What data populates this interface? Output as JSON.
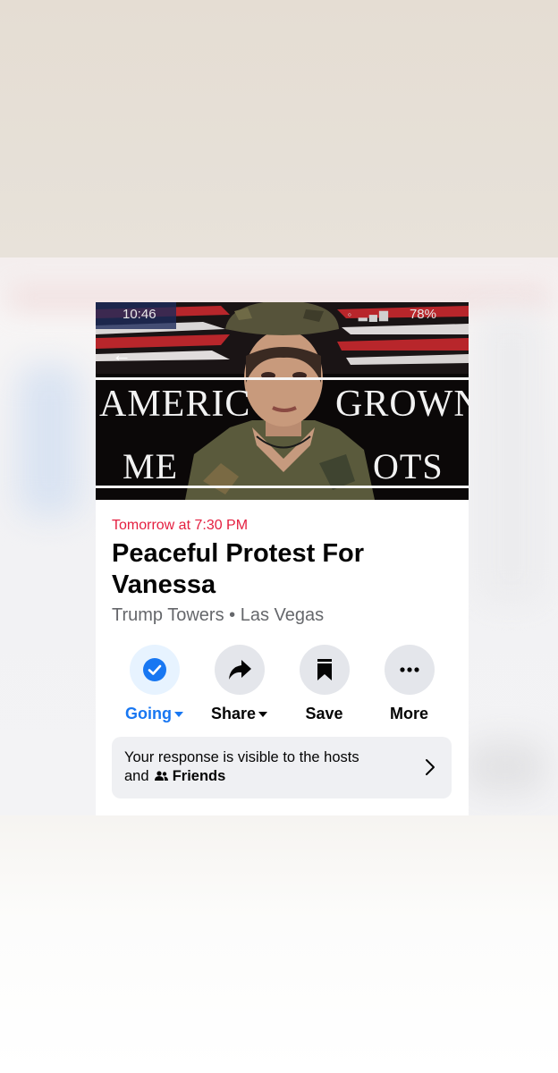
{
  "status_bar": {
    "time": "10:46",
    "battery": "78%"
  },
  "banner": {
    "line1_left": "AMERIC",
    "line1_right": "GROWN",
    "line2_left": "ME",
    "line2_right": "OTS"
  },
  "event": {
    "time": "Tomorrow at 7:30 PM",
    "title": "Peaceful Protest For Vanessa",
    "location": "Trump Towers • Las Vegas"
  },
  "actions": {
    "going": {
      "label": "Going",
      "icon": "check-circle-icon"
    },
    "share": {
      "label": "Share",
      "icon": "share-arrow-icon"
    },
    "save": {
      "label": "Save",
      "icon": "bookmark-icon"
    },
    "more": {
      "label": "More",
      "icon": "ellipsis-icon"
    }
  },
  "visibility": {
    "line1": "Your response is visible to the hosts",
    "and": "and",
    "audience": "Friends"
  },
  "colors": {
    "accent": "#1877f2",
    "event_time": "#e41e3f",
    "secondary_text": "#65676b"
  }
}
